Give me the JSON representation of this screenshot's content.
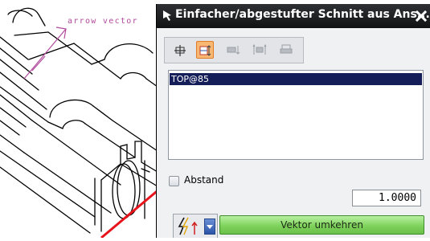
{
  "viewport": {
    "annotation": "arrow vector"
  },
  "dialog": {
    "title": "Einfacher/abgestufter Schnitt aus Ans...",
    "close_symbol": "✕",
    "toolbar_icons": [
      "section-line-icon",
      "step-section-icon",
      "add-segment-icon",
      "move-segment-icon",
      "hinge-line-icon"
    ],
    "list": {
      "items": [
        "TOP@85"
      ],
      "selected_index": 0
    },
    "distance": {
      "label": "Abstand",
      "checked": false,
      "value": "1.0000"
    },
    "vector": {
      "icon": "vector-picker-icon",
      "reverse_label": "Vektor umkehren"
    }
  },
  "colors": {
    "titlebar": "#1a1c1f",
    "selection": "#151e59",
    "accent_orange": "#f9b774",
    "green_button": "#7fd35d",
    "cad_highlight": "#e8141c",
    "annotation": "#b24a9c"
  }
}
